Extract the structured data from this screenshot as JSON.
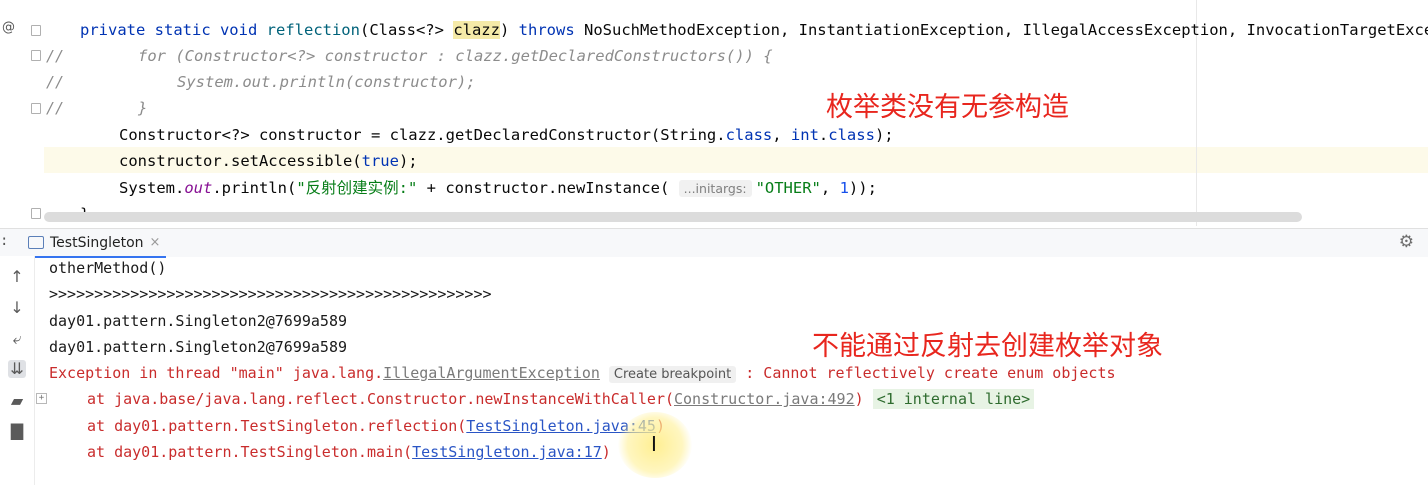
{
  "editor": {
    "gutter_marker": "@",
    "signature": {
      "kw1": "private static void",
      "name": "reflection",
      "p1": "(Class<?> ",
      "param": "clazz",
      "p2": ") ",
      "kw2": "throws",
      "rest": " NoSuchMethodException, InstantiationException, IllegalAccessException, InvocationTargetException"
    },
    "commented": [
      "for (Constructor<?> constructor : clazz.getDeclaredConstructors()) {",
      "System.out.println(constructor);",
      "}"
    ],
    "comment_prefix": "//",
    "line_ctor": {
      "a": "Constructor<?> constructor = clazz.getDeclaredConstructor(String.",
      "k1": "class",
      "b": ", ",
      "k2": "int",
      "c": ".",
      "k3": "class",
      "d": ");"
    },
    "line_access": {
      "a": "constructor.setAccessible(",
      "k": "true",
      "b": ");"
    },
    "line_print": {
      "a": "System.",
      "out": "out",
      "b": ".println(",
      "s1": "\"反射创建实例:\"",
      "c": " + constructor.newInstance( ",
      "hint": "...initargs:",
      "s2": "\"OTHER\"",
      "d": ", ",
      "n": "1",
      "e": "));"
    },
    "closing": "}"
  },
  "annotations": {
    "enum_no_default_ctor": "枚举类没有无参构造",
    "cannot_reflect_enum": "不能通过反射去创建枚举对象"
  },
  "run_panel": {
    "tab_label": "TestSingleton",
    "tab_close": "×",
    "colon": ":"
  },
  "console": {
    "line1": "otherMethod()",
    "line2": ">>>>>>>>>>>>>>>>>>>>>>>>>>>>>>>>>>>>>>>>>>>>>>>>>",
    "line3": "day01.pattern.Singleton2@7699a589",
    "line4": "day01.pattern.Singleton2@7699a589",
    "exception": {
      "prefix": "Exception in thread \"main\" java.lang.",
      "cls": "IllegalArgumentException",
      "breakpoint": "Create breakpoint",
      "message": " : Cannot reflectively create enum objects"
    },
    "trace": [
      {
        "prefix": "at java.base/java.lang.reflect.Constructor.newInstanceWithCaller(",
        "link": "Constructor.java:492",
        "suffix": ")",
        "extra": "<1 internal line>"
      },
      {
        "prefix": "at day01.pattern.TestSingleton.reflection(",
        "link": "TestSingleton.java:45",
        "suffix": ")"
      },
      {
        "prefix": "at day01.pattern.TestSingleton.main(",
        "link": "TestSingleton.java:17",
        "suffix": ")"
      }
    ]
  },
  "icons": [
    "up-arrow-icon",
    "down-arrow-icon",
    "soft-wrap-icon",
    "scroll-to-end-icon",
    "print-icon",
    "trash-icon",
    "gear-icon",
    "expand-icon",
    "run-tab-icon"
  ]
}
